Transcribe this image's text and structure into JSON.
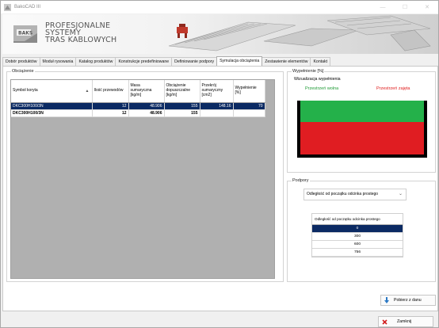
{
  "window": {
    "title": "BakoCAD III",
    "controls": [
      "—",
      "☐",
      "✕"
    ]
  },
  "banner": {
    "line1": "PROFESJONALNE",
    "line2": "SYSTEMY",
    "line3": "TRAS KABLOWYCH",
    "logo_text": "BAKS"
  },
  "tabs": [
    {
      "label": "Dobór produktów"
    },
    {
      "label": "Moduł rysowania"
    },
    {
      "label": "Katalog produktów"
    },
    {
      "label": "Konstrukcje predefiniowane"
    },
    {
      "label": "Definiowanie podpory"
    },
    {
      "label": "Symulacja obciążenia",
      "active": true
    },
    {
      "label": "Zestawienie elementów"
    },
    {
      "label": "Kontakt"
    }
  ],
  "load_group": {
    "title": "Obciążenie",
    "columns": [
      "Symbol koryta",
      "Ilość przewodów",
      "Masa sumaryczna [kg/m]",
      "Obciążenie dopuszczalne [kg/m]",
      "Przekrój sumaryczny [cm2]",
      "Wypełnienie [%]"
    ],
    "rows": [
      {
        "symbol": "DKC300H100/3N",
        "count": "12",
        "mass": "48.906",
        "allowed": "155",
        "section": "148.16",
        "fill": "70",
        "selected": true
      },
      {
        "symbol": "DKC300H100/3N",
        "count": "12",
        "mass": "48.906",
        "allowed": "155",
        "section": "",
        "fill": "",
        "selected": false
      }
    ]
  },
  "fill_group": {
    "title": "Wypełnienie [%]",
    "inner_title": "Wizualizacja wypełnienia",
    "free_label": "Przestrzeń wolna",
    "occupied_label": "Przestrzeń zajęta",
    "fill_percent": 70,
    "colors": {
      "free": "#24b14a",
      "occupied": "#e01d22"
    }
  },
  "supports_group": {
    "title": "Podpory",
    "combo_value": "Odległość od początku odcinka prostego",
    "table_header": "Odległość od początku odcinka prostego",
    "rows": [
      "0",
      "300",
      "600",
      "756"
    ],
    "selected_index": 0
  },
  "buttons": {
    "fetch": "Pobierz z danu",
    "close": "Zamknij"
  },
  "colors": {
    "selection": "#0b2a63",
    "tab_border": "#c9c9c9"
  }
}
